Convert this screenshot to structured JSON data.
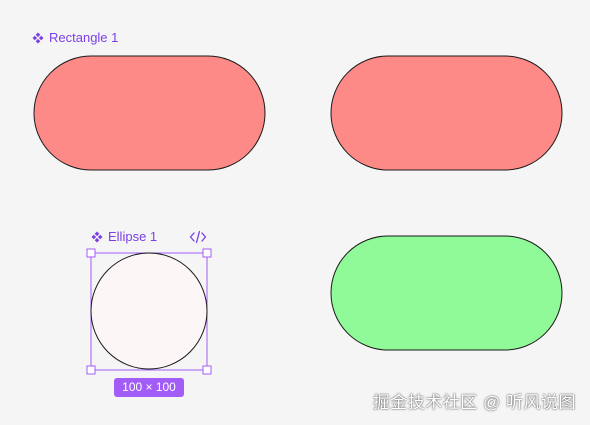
{
  "canvas": {
    "background": "#f5f5f5"
  },
  "component_labels": {
    "rectangle": "Rectangle 1",
    "ellipse": "Ellipse 1"
  },
  "selection": {
    "dimensions": "100 × 100",
    "accent_color": "#a25cf7",
    "code_icon": "code-icon"
  },
  "shapes": {
    "pill_red_fill": "#fe8a87",
    "pill_green_fill": "#8ffa97",
    "ellipse_fill": "#fdf6f6",
    "stroke": "#1a1a1a"
  },
  "watermark": "掘金技术社区 @ 听风说图"
}
